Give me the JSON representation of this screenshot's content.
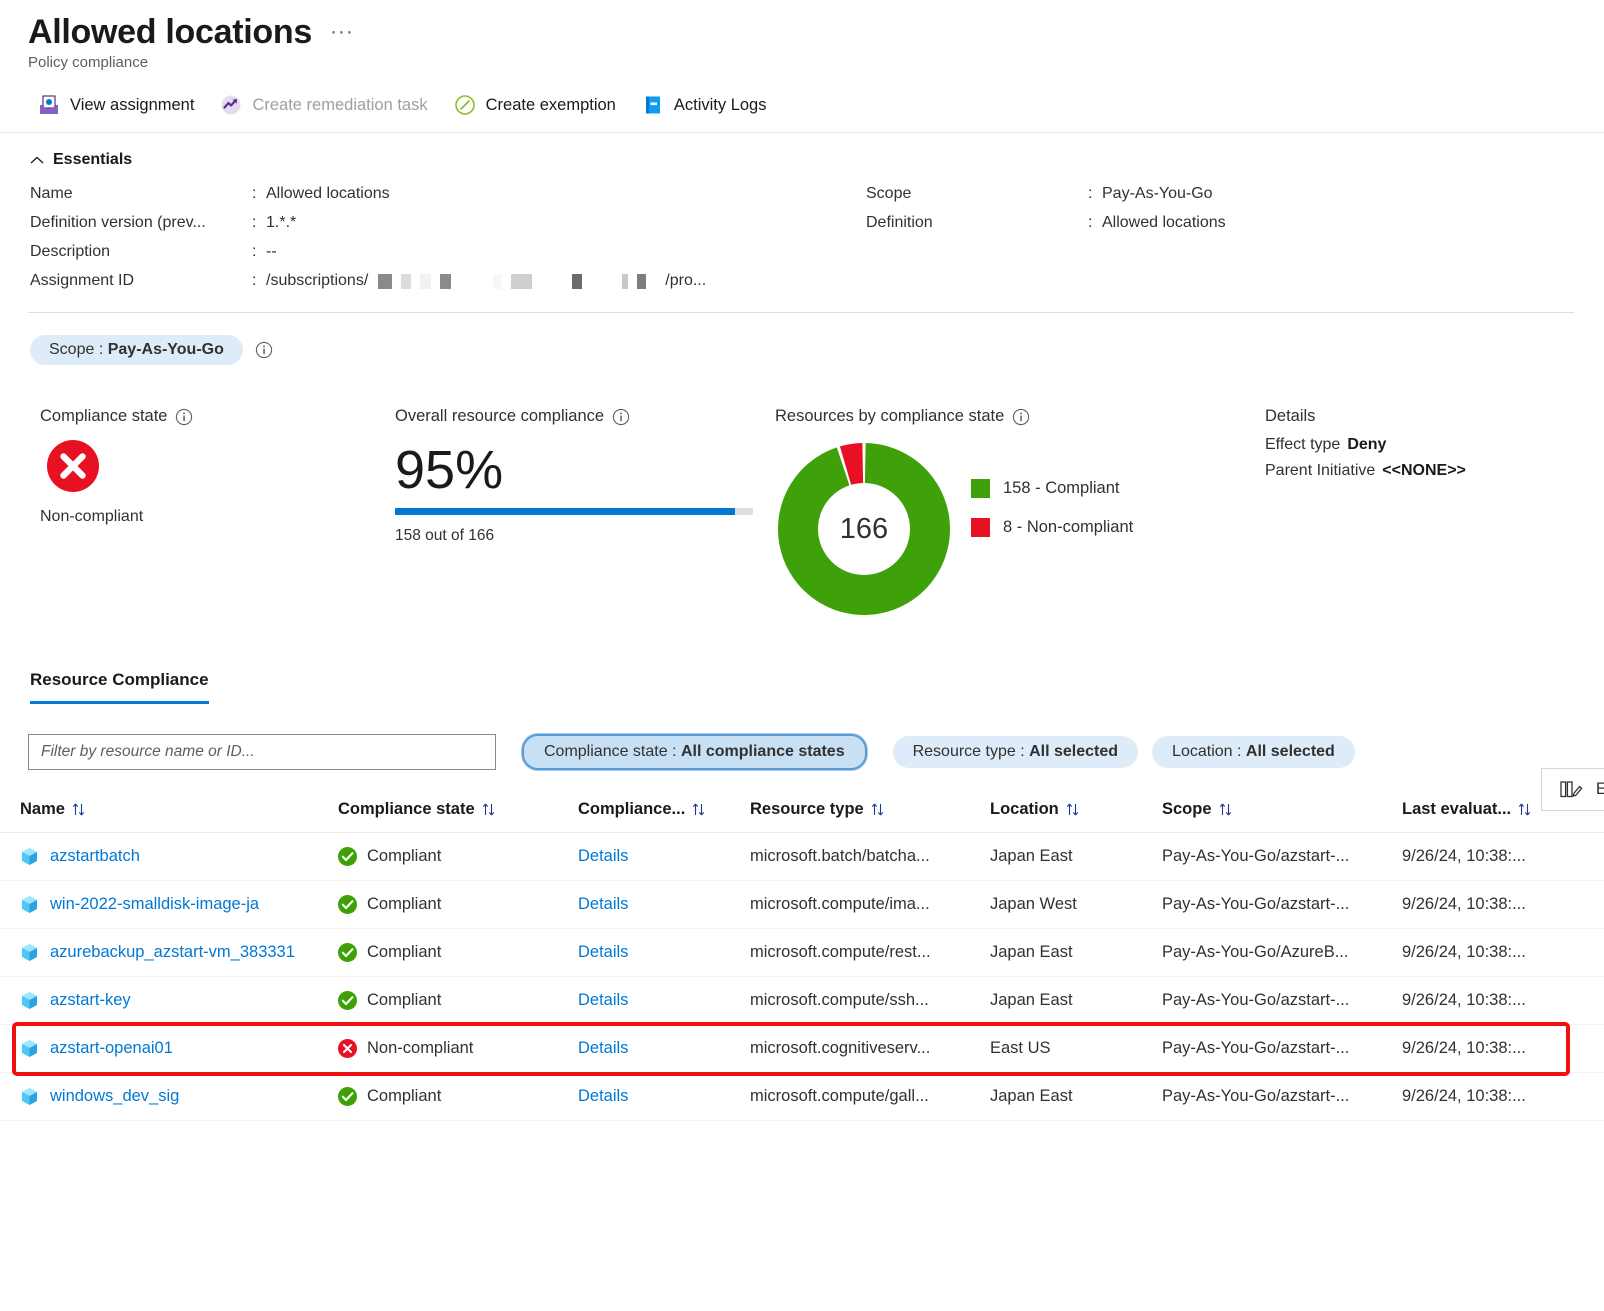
{
  "header": {
    "title": "Allowed locations",
    "more_label": "···",
    "subtitle": "Policy compliance"
  },
  "command_bar": {
    "items": [
      {
        "label": "View assignment",
        "icon": "view-assignment-icon",
        "disabled": false
      },
      {
        "label": "Create remediation task",
        "icon": "remediation-icon",
        "disabled": true
      },
      {
        "label": "Create exemption",
        "icon": "exemption-icon",
        "disabled": false
      },
      {
        "label": "Activity Logs",
        "icon": "activity-logs-icon",
        "disabled": false
      }
    ]
  },
  "essentials": {
    "heading": "Essentials",
    "left": [
      {
        "label": "Name",
        "colon": ":",
        "value": "Allowed locations"
      },
      {
        "label": "Definition version (prev...",
        "colon": ":",
        "value": "1.*.*"
      },
      {
        "label": "Description",
        "colon": ":",
        "value": "--"
      },
      {
        "label": "Assignment ID",
        "colon": ":",
        "value_prefix": "/subscriptions/",
        "value_suffix": "/pro..."
      }
    ],
    "right": [
      {
        "label": "Scope",
        "colon": ":",
        "value": "Pay-As-You-Go"
      },
      {
        "label": "Definition",
        "colon": ":",
        "value": "Allowed locations"
      }
    ]
  },
  "scope_filter": {
    "label": "Scope :",
    "value": "Pay-As-You-Go",
    "info_icon": "info-icon"
  },
  "summary": {
    "compliance_state": {
      "label": "Compliance state",
      "info_icon": "info-icon",
      "status_icon": "error-circle-icon",
      "value": "Non-compliant"
    },
    "overall": {
      "label": "Overall resource compliance",
      "info_icon": "info-icon",
      "percent": "95%",
      "progress": 95,
      "caption": "158 out of 166"
    },
    "by_state": {
      "label": "Resources by compliance state",
      "info_icon": "info-icon"
    },
    "details": {
      "title": "Details",
      "effect_type_label": "Effect type",
      "effect_type_value": "Deny",
      "parent_initiative_label": "Parent Initiative",
      "parent_initiative_value": "<<NONE>>"
    }
  },
  "chart_data": {
    "type": "pie",
    "title": "Resources by compliance state",
    "center_label": "166",
    "total": 166,
    "categories": [
      "Compliant",
      "Non-compliant"
    ],
    "values": [
      158,
      8
    ],
    "colors": [
      "#3fa10a",
      "#e81123"
    ],
    "legend": [
      {
        "swatch": "#3fa10a",
        "text": "158 - Compliant"
      },
      {
        "swatch": "#e81123",
        "text": "8 - Non-compliant"
      }
    ],
    "legend_position": "right",
    "inner_radius_ratio": 0.55
  },
  "tabs": [
    {
      "label": "Resource Compliance",
      "selected": true
    }
  ],
  "filters": {
    "search_placeholder": "Filter by resource name or ID...",
    "search_value": "",
    "pills": [
      {
        "label": "Compliance state :",
        "value": "All compliance states",
        "selected": true
      },
      {
        "label": "Resource type :",
        "value": "All selected",
        "selected": false
      },
      {
        "label": "Location :",
        "value": "All selected",
        "selected": false
      }
    ],
    "edit_columns_label": "Ed",
    "edit_columns_icon": "edit-columns-icon"
  },
  "table": {
    "columns": [
      {
        "label": "Name",
        "sort_icon": "sort-icon"
      },
      {
        "label": "Compliance state",
        "sort_icon": "sort-icon"
      },
      {
        "label": "Compliance...",
        "sort_icon": "sort-icon"
      },
      {
        "label": "Resource type",
        "sort_icon": "sort-icon"
      },
      {
        "label": "Location",
        "sort_icon": "sort-icon"
      },
      {
        "label": "Scope",
        "sort_icon": "sort-icon"
      },
      {
        "label": "Last evaluat...",
        "sort_icon": "sort-icon"
      }
    ],
    "rows": [
      {
        "name": "azstartbatch",
        "state": "Compliant",
        "state_kind": "compliant",
        "details": "Details",
        "resource_type": "microsoft.batch/batcha...",
        "location": "Japan East",
        "scope": "Pay-As-You-Go/azstart-...",
        "last_evaluated": "9/26/24, 10:38:...",
        "highlighted": false
      },
      {
        "name": "win-2022-smalldisk-image-ja",
        "state": "Compliant",
        "state_kind": "compliant",
        "details": "Details",
        "resource_type": "microsoft.compute/ima...",
        "location": "Japan West",
        "scope": "Pay-As-You-Go/azstart-...",
        "last_evaluated": "9/26/24, 10:38:...",
        "highlighted": false
      },
      {
        "name": "azurebackup_azstart-vm_383331",
        "state": "Compliant",
        "state_kind": "compliant",
        "details": "Details",
        "resource_type": "microsoft.compute/rest...",
        "location": "Japan East",
        "scope": "Pay-As-You-Go/AzureB...",
        "last_evaluated": "9/26/24, 10:38:...",
        "highlighted": false
      },
      {
        "name": "azstart-key",
        "state": "Compliant",
        "state_kind": "compliant",
        "details": "Details",
        "resource_type": "microsoft.compute/ssh...",
        "location": "Japan East",
        "scope": "Pay-As-You-Go/azstart-...",
        "last_evaluated": "9/26/24, 10:38:...",
        "highlighted": false
      },
      {
        "name": "azstart-openai01",
        "state": "Non-compliant",
        "state_kind": "non-compliant",
        "details": "Details",
        "resource_type": "microsoft.cognitiveserv...",
        "location": "East US",
        "scope": "Pay-As-You-Go/azstart-...",
        "last_evaluated": "9/26/24, 10:38:...",
        "highlighted": true
      },
      {
        "name": "windows_dev_sig",
        "state": "Compliant",
        "state_kind": "compliant",
        "details": "Details",
        "resource_type": "microsoft.compute/gall...",
        "location": "Japan East",
        "scope": "Pay-As-You-Go/azstart-...",
        "last_evaluated": "9/26/24, 10:38:...",
        "highlighted": false
      }
    ]
  },
  "colors": {
    "accent": "#0078d4",
    "compliant_green": "#3fa10a",
    "noncompliant_red": "#e81123",
    "highlight_red": "#ee1111",
    "pill_blue": "#deecf9"
  }
}
